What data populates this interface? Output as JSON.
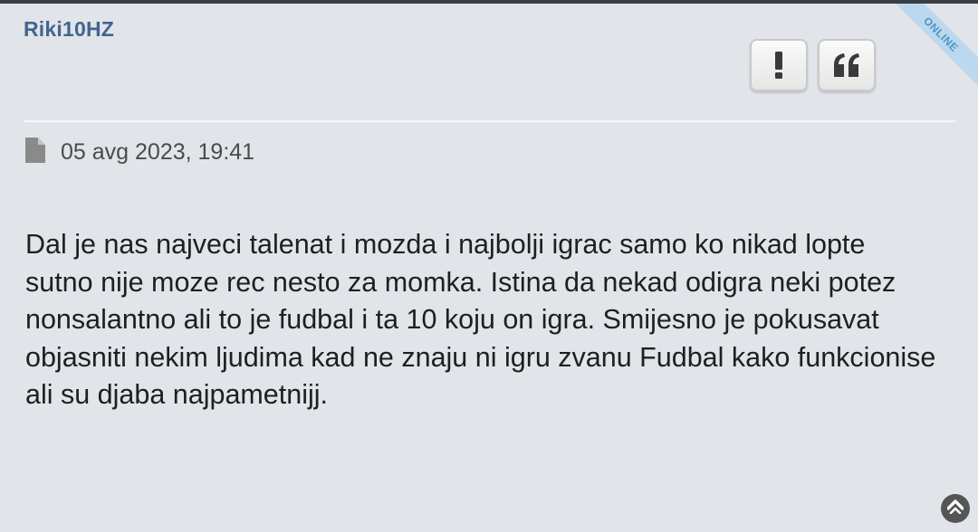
{
  "post": {
    "author": "Riki10HZ",
    "status_ribbon": "ONLINE",
    "date": "05 avg 2023, 19:41",
    "body": "Dal je nas najveci talenat i mozda i najbolji igrac samo ko nikad lopte sutno nije moze rec nesto za momka. Istina da nekad odigra neki potez nonsalantno ali to je fudbal i ta 10 koju on igra. Smijesno je pokusavat objasniti nekim ljudima kad ne znaju ni igru zvanu Fudbal kako funkcionise ali su djaba najpametnijj."
  },
  "icons": {
    "report": "exclamation-icon",
    "quote": "quote-icon",
    "post": "document-icon",
    "scroll_top": "chevron-up-circle-icon"
  },
  "colors": {
    "background": "#e1e4e9",
    "author": "#41658e",
    "ribbon_bg": "#bcd8ee",
    "ribbon_text": "#4a95c9",
    "top_bar": "#3a3d42"
  }
}
